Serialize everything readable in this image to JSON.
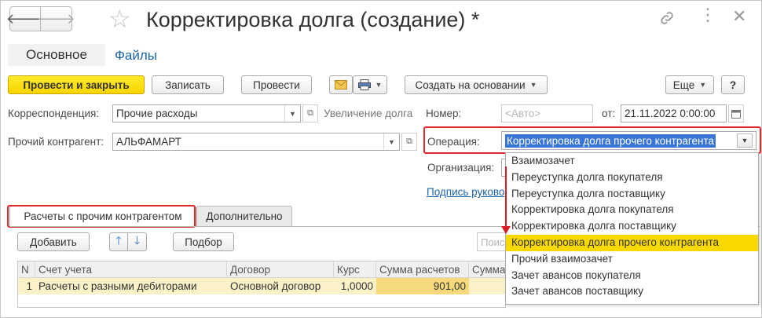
{
  "window": {
    "title": "Корректировка долга (создание) *"
  },
  "page_tabs": {
    "main": "Основное",
    "files": "Файлы"
  },
  "toolbar": {
    "post_close": "Провести и закрыть",
    "save": "Записать",
    "post": "Провести",
    "create_based": "Создать на основании",
    "more": "Еще",
    "help": "?"
  },
  "form": {
    "correspondence_label": "Корреспонденция:",
    "correspondence_value": "Прочие расходы",
    "increase_debt": "Увеличение долга",
    "number_label": "Номер:",
    "number_placeholder": "<Авто>",
    "date_label": "от:",
    "date_value": "21.11.2022  0:00:00",
    "counterparty_label": "Прочий контрагент:",
    "counterparty_value": "АЛЬФАМАРТ",
    "operation_label": "Операция:",
    "operation_value": "Корректировка долга прочего контрагента",
    "organization_label": "Организация:",
    "signature_link": "Подпись руково"
  },
  "operation_options": [
    "Взаимозачет",
    "Переуступка долга покупателя",
    "Переуступка долга поставщику",
    "Корректировка долга покупателя",
    "Корректировка долга поставщику",
    "Корректировка долга прочего контрагента",
    "Прочий взаимозачет",
    "Зачет авансов покупателя",
    "Зачет авансов поставщику"
  ],
  "operation_highlighted_index": 5,
  "sub_tabs": {
    "settlements": "Расчеты с прочим контрагентом",
    "additional": "Дополнительно"
  },
  "table_toolbar": {
    "add": "Добавить",
    "pick": "Подбор",
    "search_placeholder": "Поиск"
  },
  "table": {
    "headers": [
      "N",
      "Счет учета",
      "Договор",
      "Курс",
      "Сумма расчетов",
      "Сумма у"
    ],
    "rows": [
      [
        "1",
        "Расчеты с разными дебиторами",
        "Основной договор",
        "1,0000",
        "901,00",
        ""
      ]
    ]
  },
  "colors": {
    "accent_yellow": "#f7d400",
    "highlight_red": "#e0282e",
    "link_blue": "#1a64ab",
    "selection_blue": "#3875d7"
  },
  "icons": [
    "arrow-left-icon",
    "arrow-right-icon",
    "star-icon",
    "link-icon",
    "more-icon",
    "close-icon",
    "envelope-icon",
    "printer-icon",
    "copy-icon",
    "arrow-up-icon",
    "arrow-down-icon"
  ]
}
